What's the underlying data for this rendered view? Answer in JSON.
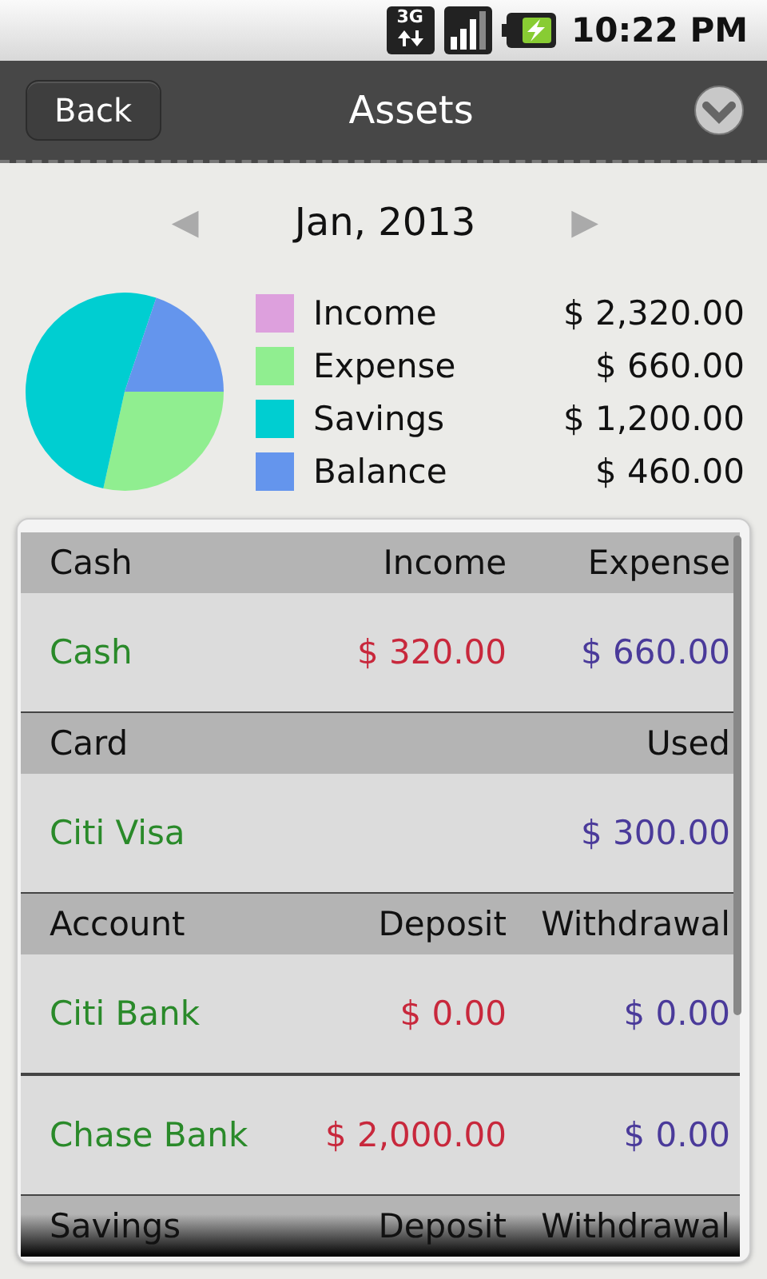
{
  "status_bar": {
    "network": "3G",
    "time": "10:22 PM"
  },
  "header": {
    "back": "Back",
    "title": "Assets"
  },
  "month": {
    "label": "Jan, 2013",
    "prev": "◀",
    "next": "▶"
  },
  "legend": [
    {
      "label": "Income",
      "amount": "$ 2,320.00",
      "color": "#dda0dd"
    },
    {
      "label": "Expense",
      "amount": "$ 660.00",
      "color": "#90ee90"
    },
    {
      "label": "Savings",
      "amount": "$ 1,200.00",
      "color": "#00ced1"
    },
    {
      "label": "Balance",
      "amount": "$ 460.00",
      "color": "#6495ed"
    }
  ],
  "pie": {
    "chart_data": {
      "type": "pie",
      "values": [
        28.45,
        51.72,
        19.83
      ]
    }
  },
  "sections": [
    {
      "header": {
        "column_1": "Cash",
        "column_2": "Income",
        "column_3": "Expense"
      },
      "rows": [
        {
          "name": "Cash",
          "column_2": "$ 320.00",
          "column_3": "$ 660.00"
        }
      ]
    },
    {
      "header": {
        "column_1": "Card",
        "column_3": "Used"
      },
      "rows": [
        {
          "name": "Citi Visa",
          "column_3": "$ 300.00"
        }
      ]
    },
    {
      "header": {
        "column_1": "Account",
        "column_2": "Deposit",
        "column_3": "Withdrawal"
      },
      "rows": [
        {
          "name": "Citi Bank",
          "column_2": "$ 0.00",
          "column_3": "$ 0.00"
        },
        {
          "name": "Chase Bank",
          "column_2": "$ 2,000.00",
          "column_3": "$ 0.00"
        }
      ]
    },
    {
      "header": {
        "column_1": "Savings",
        "column_2": "Deposit",
        "column_3": "Withdrawal"
      }
    }
  ]
}
